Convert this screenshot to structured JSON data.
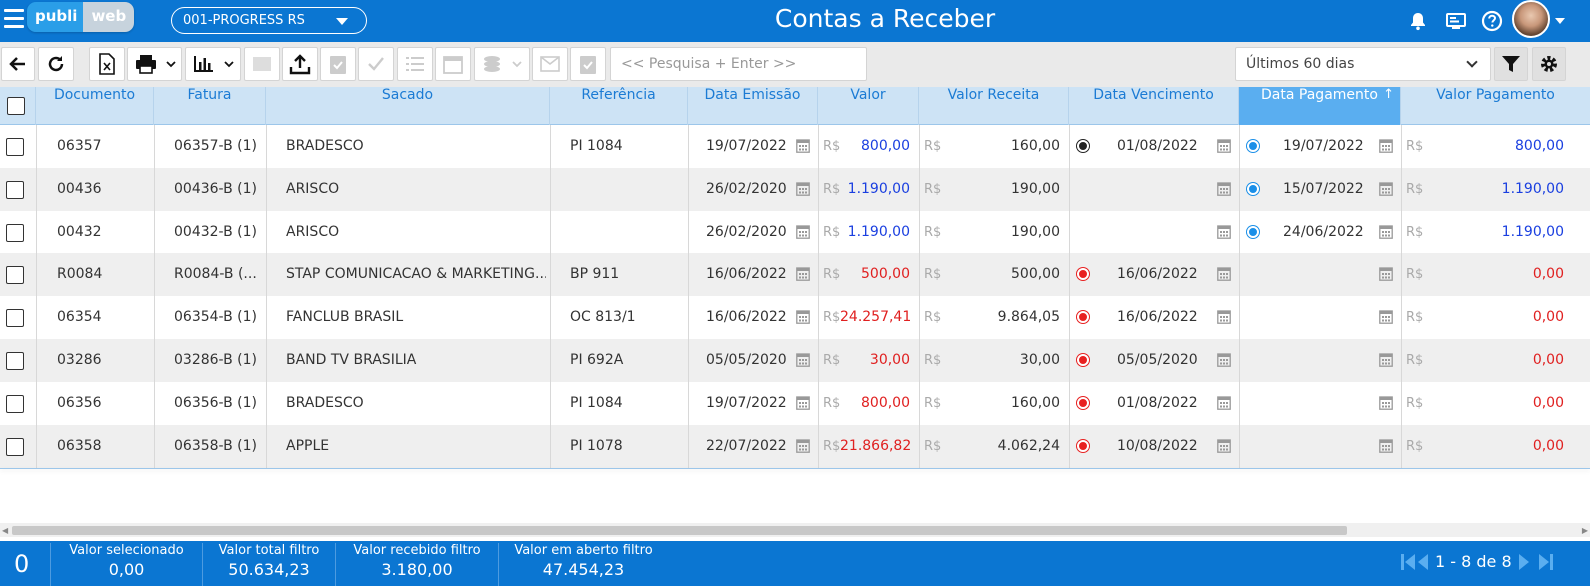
{
  "header": {
    "logo_left": "publi",
    "logo_right": "web",
    "company": "001-PROGRESS RS",
    "title": "Contas a Receber",
    "icons": [
      "bell-icon",
      "monitor-icon",
      "help-icon",
      "avatar"
    ]
  },
  "toolbar": {
    "search_placeholder": "<< Pesquisa + Enter >>",
    "period": "Últimos 60 dias",
    "icons": [
      "back-arrow-icon",
      "refresh-icon",
      "excel-icon",
      "print-icon",
      "chart-icon",
      "upload-icon",
      "clipboard-check-icon",
      "check-icon",
      "list-icon",
      "calendar-icon",
      "coins-icon",
      "mail-icon",
      "clipboard-icon",
      "filter-icon",
      "settings-icon"
    ]
  },
  "table": {
    "columns": [
      "Documento",
      "Fatura",
      "Sacado",
      "Referência",
      "Data Emissão",
      "Valor",
      "Valor Receita",
      "Data Vencimento",
      "Data Pagamento",
      "Valor Pagamento"
    ],
    "sorted_column": "Data Pagamento",
    "currency": "R$",
    "rows": [
      {
        "doc": "06357",
        "fatura": "06357-B (1)",
        "sacado": "BRADESCO",
        "ref": "PI 1084",
        "emissao": "19/07/2022",
        "valor": "800,00",
        "valor_color": "blue",
        "receita": "160,00",
        "venc_dot": "black",
        "venc": "01/08/2022",
        "pag_dot": "blue",
        "pag": "19/07/2022",
        "vpag": "800,00",
        "vpag_color": "blue"
      },
      {
        "doc": "00436",
        "fatura": "00436-B (1)",
        "sacado": "ARISCO",
        "ref": "",
        "emissao": "26/02/2020",
        "valor": "1.190,00",
        "valor_color": "blue",
        "receita": "190,00",
        "venc_dot": "",
        "venc": "",
        "pag_dot": "blue",
        "pag": "15/07/2022",
        "vpag": "1.190,00",
        "vpag_color": "blue"
      },
      {
        "doc": "00432",
        "fatura": "00432-B (1)",
        "sacado": "ARISCO",
        "ref": "",
        "emissao": "26/02/2020",
        "valor": "1.190,00",
        "valor_color": "blue",
        "receita": "190,00",
        "venc_dot": "",
        "venc": "",
        "pag_dot": "blue",
        "pag": "24/06/2022",
        "vpag": "1.190,00",
        "vpag_color": "blue"
      },
      {
        "doc": "R0084",
        "fatura": "R0084-B (...",
        "sacado": "STAP COMUNICACAO & MARKETING...",
        "ref": "BP 911",
        "emissao": "16/06/2022",
        "valor": "500,00",
        "valor_color": "red",
        "receita": "500,00",
        "venc_dot": "red",
        "venc": "16/06/2022",
        "pag_dot": "",
        "pag": "",
        "vpag": "0,00",
        "vpag_color": "red"
      },
      {
        "doc": "06354",
        "fatura": "06354-B (1)",
        "sacado": "FANCLUB BRASIL",
        "ref": "OC 813/1",
        "emissao": "16/06/2022",
        "valor": "24.257,41",
        "valor_color": "red",
        "receita": "9.864,05",
        "venc_dot": "red",
        "venc": "16/06/2022",
        "pag_dot": "",
        "pag": "",
        "vpag": "0,00",
        "vpag_color": "red"
      },
      {
        "doc": "03286",
        "fatura": "03286-B (1)",
        "sacado": "BAND TV BRASILIA",
        "ref": "PI 692A",
        "emissao": "05/05/2020",
        "valor": "30,00",
        "valor_color": "red",
        "receita": "30,00",
        "venc_dot": "red",
        "venc": "05/05/2020",
        "pag_dot": "",
        "pag": "",
        "vpag": "0,00",
        "vpag_color": "red"
      },
      {
        "doc": "06356",
        "fatura": "06356-B (1)",
        "sacado": "BRADESCO",
        "ref": "PI 1084",
        "emissao": "19/07/2022",
        "valor": "800,00",
        "valor_color": "red",
        "receita": "160,00",
        "venc_dot": "red",
        "venc": "01/08/2022",
        "pag_dot": "",
        "pag": "",
        "vpag": "0,00",
        "vpag_color": "red"
      },
      {
        "doc": "06358",
        "fatura": "06358-B (1)",
        "sacado": "APPLE",
        "ref": "PI 1078",
        "emissao": "22/07/2022",
        "valor": "21.866,82",
        "valor_color": "red",
        "receita": "4.062,24",
        "venc_dot": "red",
        "venc": "10/08/2022",
        "pag_dot": "",
        "pag": "",
        "vpag": "0,00",
        "vpag_color": "red"
      }
    ]
  },
  "footer": {
    "selected_count": "0",
    "items": [
      {
        "label": "Valor selecionado",
        "value": "0,00"
      },
      {
        "label": "Valor total filtro",
        "value": "50.634,23"
      },
      {
        "label": "Valor recebido filtro",
        "value": "3.180,00"
      },
      {
        "label": "Valor em aberto filtro",
        "value": "47.454,23"
      }
    ],
    "pager": "1 - 8 de 8"
  },
  "colors": {
    "brand": "#0b76d2",
    "header_row": "#cde3f5",
    "sorted_header": "#5aaef0",
    "blue_value": "#1a3fe0",
    "red_value": "#e02020"
  }
}
